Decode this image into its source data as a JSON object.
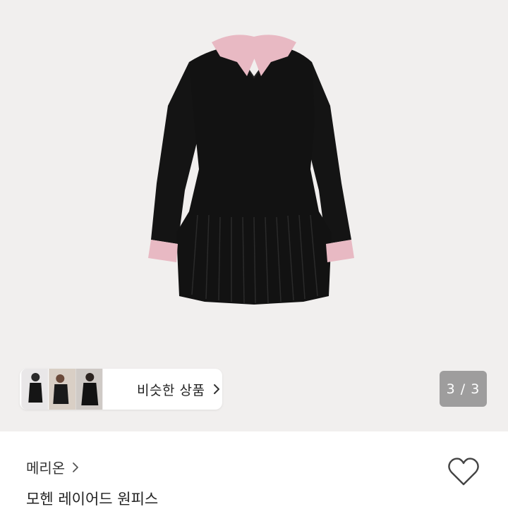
{
  "similar": {
    "label": "비슷한 상품",
    "chevron_icon": "chevron-right-icon"
  },
  "pager": {
    "text": "3 / 3"
  },
  "shop": {
    "name": "메리온",
    "chevron_icon": "chevron-right-icon"
  },
  "product": {
    "title": "모헨 레이어드 원피스",
    "like_icon": "heart-outline-icon"
  },
  "colors": {
    "hero_background": "#f1efee",
    "dress": "#111111",
    "collar_pink": "#e8b9c3"
  }
}
